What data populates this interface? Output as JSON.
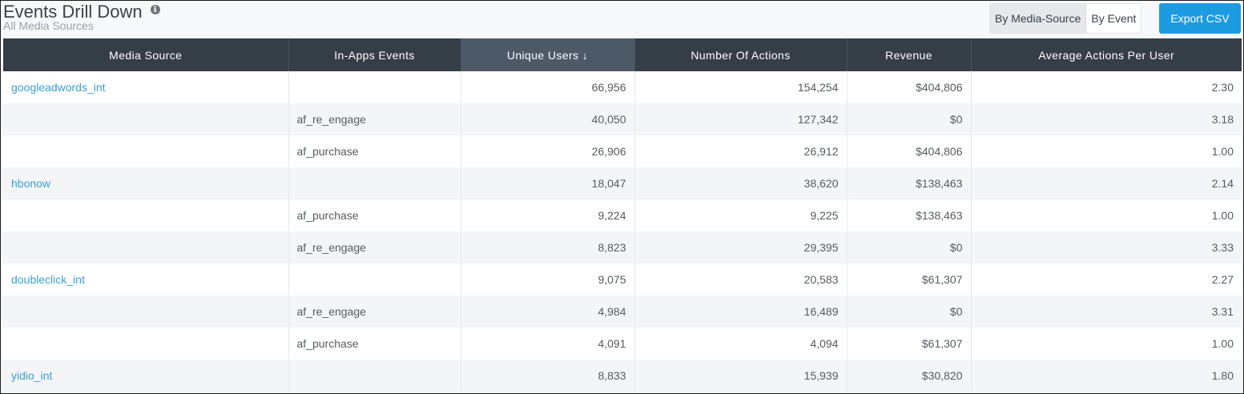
{
  "header": {
    "title": "Events Drill Down",
    "subtitle": "All Media Sources",
    "info_icon": "info-icon"
  },
  "toolbar": {
    "toggle": {
      "by_media_source": "By Media-Source",
      "by_event": "By Event",
      "active": "by_media_source"
    },
    "export_label": "Export CSV"
  },
  "colors": {
    "header_bg": "#353d46",
    "sorted_header_bg": "#4d5967",
    "link": "#3a9fd3",
    "export_button": "#1d9be1"
  },
  "table": {
    "columns": [
      {
        "label": "Media Source"
      },
      {
        "label": "In-Apps Events"
      },
      {
        "label": "Unique Users ↓",
        "sorted": "desc"
      },
      {
        "label": "Number Of Actions"
      },
      {
        "label": "Revenue"
      },
      {
        "label": "Average Actions Per User"
      }
    ],
    "rows": [
      {
        "source": "googleadwords_int",
        "event": "",
        "users": "66,956",
        "actions": "154,254",
        "revenue": "$404,806",
        "avg": "2.30"
      },
      {
        "source": "",
        "event": "af_re_engage",
        "users": "40,050",
        "actions": "127,342",
        "revenue": "$0",
        "avg": "3.18"
      },
      {
        "source": "",
        "event": "af_purchase",
        "users": "26,906",
        "actions": "26,912",
        "revenue": "$404,806",
        "avg": "1.00"
      },
      {
        "source": "hbonow",
        "event": "",
        "users": "18,047",
        "actions": "38,620",
        "revenue": "$138,463",
        "avg": "2.14"
      },
      {
        "source": "",
        "event": "af_purchase",
        "users": "9,224",
        "actions": "9,225",
        "revenue": "$138,463",
        "avg": "1.00"
      },
      {
        "source": "",
        "event": "af_re_engage",
        "users": "8,823",
        "actions": "29,395",
        "revenue": "$0",
        "avg": "3.33"
      },
      {
        "source": "doubleclick_int",
        "event": "",
        "users": "9,075",
        "actions": "20,583",
        "revenue": "$61,307",
        "avg": "2.27"
      },
      {
        "source": "",
        "event": "af_re_engage",
        "users": "4,984",
        "actions": "16,489",
        "revenue": "$0",
        "avg": "3.31"
      },
      {
        "source": "",
        "event": "af_purchase",
        "users": "4,091",
        "actions": "4,094",
        "revenue": "$61,307",
        "avg": "1.00"
      },
      {
        "source": "yidio_int",
        "event": "",
        "users": "8,833",
        "actions": "15,939",
        "revenue": "$30,820",
        "avg": "1.80"
      }
    ]
  }
}
